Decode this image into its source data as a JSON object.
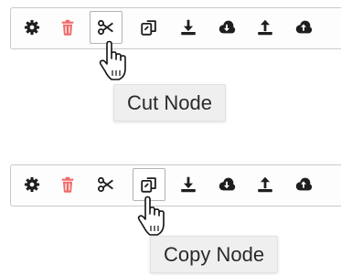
{
  "colors": {
    "icon": "#1e1e1e",
    "danger": "#f06a6a",
    "border": "#c9c9c9",
    "tooltip_bg": "#efefef"
  },
  "toolbar_buttons": [
    {
      "name": "settings",
      "icon": "gear-icon"
    },
    {
      "name": "delete",
      "icon": "trash-icon"
    },
    {
      "name": "cut",
      "icon": "scissors-icon"
    },
    {
      "name": "copy",
      "icon": "copy-icon"
    },
    {
      "name": "download",
      "icon": "download-icon"
    },
    {
      "name": "cloud-download",
      "icon": "cloud-download-icon"
    },
    {
      "name": "upload",
      "icon": "upload-icon"
    },
    {
      "name": "cloud-upload",
      "icon": "cloud-upload-icon"
    }
  ],
  "frames": [
    {
      "pressed": "cut",
      "tooltip": "Cut Node"
    },
    {
      "pressed": "copy",
      "tooltip": "Copy Node"
    }
  ]
}
